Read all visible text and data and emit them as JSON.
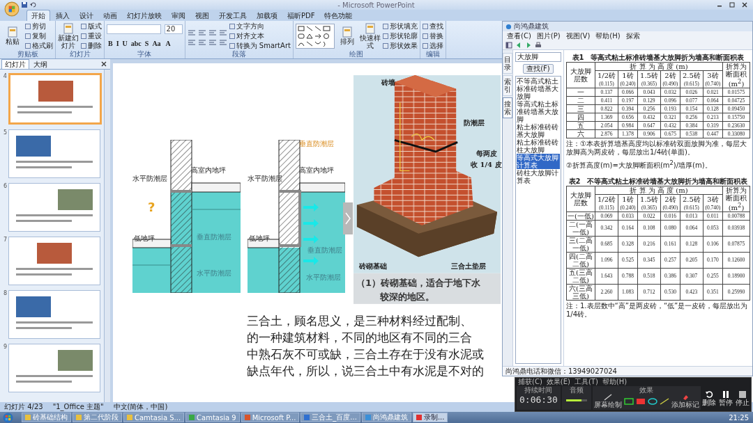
{
  "window": {
    "title": "- Microsoft PowerPoint"
  },
  "ribbon_tabs": [
    {
      "label": "开始",
      "selected": true
    },
    {
      "label": "插入",
      "selected": false
    },
    {
      "label": "设计",
      "selected": false
    },
    {
      "label": "动画",
      "selected": false
    },
    {
      "label": "幻灯片放映",
      "selected": false
    },
    {
      "label": "审阅",
      "selected": false
    },
    {
      "label": "视图",
      "selected": false
    },
    {
      "label": "开发工具",
      "selected": false
    },
    {
      "label": "加载项",
      "selected": false
    },
    {
      "label": "福昕PDF",
      "selected": false
    },
    {
      "label": "特色功能",
      "selected": false
    }
  ],
  "ribbon_groups": [
    {
      "label": "剪贴板",
      "columns": [
        [
          {
            "kind": "large",
            "label": "粘贴"
          }
        ],
        [
          {
            "kind": "small",
            "label": "剪切"
          },
          {
            "kind": "small",
            "label": "复制"
          },
          {
            "kind": "small",
            "label": "格式刷"
          }
        ]
      ]
    },
    {
      "label": "幻灯片",
      "columns": [
        [
          {
            "kind": "large",
            "label": "新建幻灯片"
          }
        ],
        [
          {
            "kind": "small",
            "label": "版式"
          },
          {
            "kind": "small",
            "label": "重设"
          },
          {
            "kind": "small",
            "label": "删除"
          }
        ]
      ]
    },
    {
      "label": "字体",
      "columns": [
        [
          {
            "kind": "field"
          },
          {
            "kind": "glyphs",
            "labels": [
              "B",
              "I",
              "U",
              "abc",
              "S",
              "Aa"
            ]
          }
        ],
        [
          {
            "kind": "field",
            "value": "20"
          },
          {
            "kind": "glyphs",
            "labels": [
              "A"
            ]
          }
        ]
      ]
    },
    {
      "label": "段落",
      "columns": [
        [
          {
            "kind": "align"
          }
        ],
        [
          {
            "kind": "small",
            "label": "文字方向"
          },
          {
            "kind": "small",
            "label": "对齐文本"
          },
          {
            "kind": "small",
            "label": "转换为 SmartArt"
          }
        ]
      ]
    },
    {
      "label": "绘图",
      "columns": [
        [
          {
            "kind": "shapes"
          }
        ],
        [
          {
            "kind": "large",
            "label": "排列"
          }
        ],
        [
          {
            "kind": "large",
            "label": "快速样式"
          }
        ],
        [
          {
            "kind": "small",
            "label": "形状填充"
          },
          {
            "kind": "small",
            "label": "形状轮廓"
          },
          {
            "kind": "small",
            "label": "形状效果"
          }
        ]
      ]
    },
    {
      "label": "编辑",
      "columns": [
        [
          {
            "kind": "small",
            "label": "查找"
          },
          {
            "kind": "small",
            "label": "替换"
          },
          {
            "kind": "small",
            "label": "选择"
          }
        ]
      ]
    }
  ],
  "pane_tabs": [
    {
      "label": "幻灯片",
      "selected": true
    },
    {
      "label": "大纲",
      "selected": false
    }
  ],
  "thumbnails": [
    {
      "number": "4",
      "selected": true
    },
    {
      "number": "5",
      "selected": false
    },
    {
      "number": "6",
      "selected": false
    },
    {
      "number": "7",
      "selected": false
    },
    {
      "number": "8",
      "selected": false
    },
    {
      "number": "9",
      "selected": false
    }
  ],
  "slide": {
    "diagrams": [
      {
        "labels": [
          "水平防潮层",
          "高室内地坪",
          "低地坪",
          "垂直防潮层",
          "水平防潮层"
        ],
        "annotation": "?"
      },
      {
        "labels": [
          "垂直防潮层",
          "水平防潮层",
          "高室内地坪",
          "低地坪",
          "垂直防潮层",
          "水平防潮层"
        ]
      }
    ],
    "brick": {
      "labels": [
        "砖墙",
        "防潮层",
        "每两皮",
        "收 1/4 皮",
        "砖砌基础",
        "三合土垫层"
      ],
      "caption": [
        "（1）砖砌基础，适合于地下水",
        "较深的地区。"
      ]
    },
    "paragraph": [
      "三合土，顾名思义，是三种材料经过配制、",
      "的一种建筑材料，不同的地区有不同的三合",
      "中熟石灰不可或缺，三合土存在于没有水泥或",
      "缺点年代，所以，说三合土中有水泥是不对的"
    ]
  },
  "help_window": {
    "title": "尚鸿鼎建筑",
    "menu": [
      "查看(C)",
      "图片(P)",
      "视图(V)",
      "帮助(H)",
      "探索"
    ],
    "side_tabs": [
      {
        "label": "目录",
        "selected": false
      },
      {
        "label": "索引",
        "selected": false
      },
      {
        "label": "搜索",
        "selected": true
      }
    ],
    "search": {
      "value": "大放脚"
    },
    "find_button": "查找(F)",
    "results": [
      {
        "label": "不等高式粘土标准砖墙基大放脚",
        "selected": false
      },
      {
        "label": "等高式粘土标准砖墙基大放脚",
        "selected": false
      },
      {
        "label": "粘土标准砖砖基大放脚",
        "selected": false
      },
      {
        "label": "粘土标准砖砖柱大放脚",
        "selected": false
      },
      {
        "label": "等高式大放脚计算表",
        "selected": true
      },
      {
        "label": "砖柱大放脚计算表",
        "selected": false
      }
    ],
    "tables": [
      {
        "title": "表1　等高式粘土标准砖墙基大放脚折为墙高和断面积表",
        "row_header": "大放脚层数",
        "group_header": "折 算 为 高 度 (m)",
        "sub_headers": [
          {
            "label": "1/2砖",
            "value": "(0.115)"
          },
          {
            "label": "1砖",
            "value": "(0.240)"
          },
          {
            "label": "1.5砖",
            "value": "(0.365)"
          },
          {
            "label": "2砖",
            "value": "(0.490)"
          },
          {
            "label": "2.5砖",
            "value": "(0.615)"
          },
          {
            "label": "3砖",
            "value": "(0.740)"
          }
        ],
        "last_header": "折算为断面积(m$^{2}$)",
        "rows": [
          {
            "label": "一",
            "values": [
              "0.137",
              "0.066",
              "0.043",
              "0.032",
              "0.026",
              "0.021",
              "0.01575"
            ]
          },
          {
            "label": "二",
            "values": [
              "0.411",
              "0.197",
              "0.129",
              "0.096",
              "0.077",
              "0.064",
              "0.04725"
            ]
          },
          {
            "label": "三",
            "values": [
              "0.822",
              "0.394",
              "0.256",
              "0.193",
              "0.154",
              "0.128",
              "0.09450"
            ]
          },
          {
            "label": "四",
            "values": [
              "1.369",
              "0.656",
              "0.432",
              "0.321",
              "0.256",
              "0.213",
              "0.15750"
            ]
          },
          {
            "label": "五",
            "values": [
              "2.054",
              "0.984",
              "0.647",
              "0.432",
              "0.384",
              "0.319",
              "0.23630"
            ]
          },
          {
            "label": "六",
            "values": [
              "2.876",
              "1.378",
              "0.906",
              "0.675",
              "0.538",
              "0.447",
              "0.33080"
            ]
          }
        ],
        "notes": [
          "注：①本表折算墙基高度均以标准砖双面放脚为准，每层大放脚高为两皮砖，每层放出1/4砖(单面)。",
          "②折算高度(m)=大放脚断面积(m$^{2}$)/墙厚(m)。"
        ]
      },
      {
        "title": "表2　不等高式粘土标准砖墙基大放脚折为墙高和断面积表",
        "row_header": "大放脚层数",
        "group_header": "折 算 为 高 度 (m)",
        "sub_headers": [
          {
            "label": "1/2砖",
            "value": "(0.115)"
          },
          {
            "label": "1砖",
            "value": "(0.240)"
          },
          {
            "label": "1.5砖",
            "value": "(0.365)"
          },
          {
            "label": "2砖",
            "value": "(0.490)"
          },
          {
            "label": "2.5砖",
            "value": "(0.615)"
          },
          {
            "label": "3砖",
            "value": "(0.740)"
          }
        ],
        "last_header": "折算为断面积(m$^{2}$)",
        "rows": [
          {
            "label": "一(一低)",
            "values": [
              "0.069",
              "0.033",
              "0.022",
              "0.016",
              "0.013",
              "0.011",
              "0.00788"
            ]
          },
          {
            "label": "二(一高一低)",
            "values": [
              "0.342",
              "0.164",
              "0.108",
              "0.080",
              "0.064",
              "0.053",
              "0.03938"
            ]
          },
          {
            "label": "三(二高一低)",
            "values": [
              "0.685",
              "0.328",
              "0.216",
              "0.161",
              "0.128",
              "0.106",
              "0.07875"
            ]
          },
          {
            "label": "四(二高二低)",
            "values": [
              "1.096",
              "0.525",
              "0.345",
              "0.257",
              "0.205",
              "0.170",
              "0.12600"
            ]
          },
          {
            "label": "五(三高二低)",
            "values": [
              "1.643",
              "0.788",
              "0.518",
              "0.386",
              "0.307",
              "0.255",
              "0.18900"
            ]
          },
          {
            "label": "六(三高三低)",
            "values": [
              "2.260",
              "1.083",
              "0.712",
              "0.530",
              "0.423",
              "0.351",
              "0.25990"
            ]
          }
        ],
        "notes": [
          "注：1.表层数中“高”是两皮砖，“低”是一皮砖，每层放出为1/4砖。"
        ]
      }
    ],
    "footer": "尚鸿鼎电话和微信：13949027024"
  },
  "recorder": {
    "menu": [
      "捕获(C)",
      "效果(E)",
      "工具(T)",
      "帮助(H)"
    ],
    "duration_label": "持续时间",
    "duration": "0:06:30",
    "audio_label": "音频",
    "audio": {
      "level": 0.75
    },
    "effects_label": "效果",
    "tools": [
      "屏幕绘制",
      "添加标记"
    ],
    "buttons": [
      "删除",
      "暂停",
      "停止"
    ]
  },
  "status_bar": [
    "幻灯片 4/23",
    "\"1_Office 主题\"",
    "中文(简体，中国)"
  ],
  "taskbar": {
    "items": [
      {
        "label": "砖基础结构",
        "color": "#e8c040",
        "selected": false
      },
      {
        "label": "第二代阶段",
        "color": "#e8c040",
        "selected": false
      },
      {
        "label": "Camtasia S...",
        "color": "#e8c040",
        "selected": false
      },
      {
        "label": "Camtasia 9",
        "color": "#3aa845",
        "selected": false
      },
      {
        "label": "Microsoft P...",
        "color": "#d9542b",
        "selected": false
      },
      {
        "label": "三合土_百度...",
        "color": "#2f6fd0",
        "selected": false
      },
      {
        "label": "尚鸿鼎建筑",
        "color": "#3a8fd8",
        "selected": false
      },
      {
        "label": "录制...",
        "color": "#e03030",
        "selected": true
      }
    ],
    "clock": "21:25"
  }
}
